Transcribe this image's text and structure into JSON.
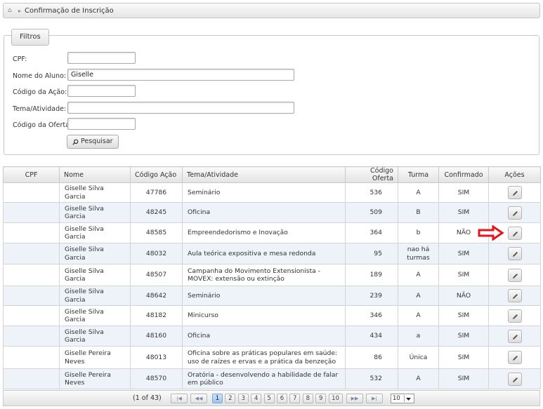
{
  "breadcrumb": {
    "title": "Confirmação de Inscrição",
    "home_icon": "home-icon"
  },
  "filters": {
    "legend": "Filtros",
    "fields": {
      "cpf": {
        "label": "CPF:",
        "value": ""
      },
      "aluno": {
        "label": "Nome do Aluno:",
        "value": "Giselle"
      },
      "codigo_acao": {
        "label": "Código da Ação:",
        "value": ""
      },
      "tema": {
        "label": "Tema/Atividade:",
        "value": ""
      },
      "codigo_oferta": {
        "label": "Código da Oferta:",
        "value": ""
      }
    },
    "search_button": "Pesquisar"
  },
  "table": {
    "headers": [
      "CPF",
      "Nome",
      "Código Ação",
      "Tema/Atividade",
      "Código Oferta",
      "Turma",
      "Confirmado",
      "Ações"
    ],
    "rows": [
      {
        "cpf": "",
        "nome": "Giselle Silva Garcia",
        "codigo_acao": "47786",
        "tema": "Seminário",
        "codigo_oferta": "536",
        "turma": "A",
        "confirmado": "SIM"
      },
      {
        "cpf": "",
        "nome": "Giselle Silva Garcia",
        "codigo_acao": "48245",
        "tema": "Oficina",
        "codigo_oferta": "509",
        "turma": "B",
        "confirmado": "SIM"
      },
      {
        "cpf": "",
        "nome": "Giselle Silva Garcia",
        "codigo_acao": "48585",
        "tema": "Empreendedorismo e Inovação",
        "codigo_oferta": "364",
        "turma": "b",
        "confirmado": "NÃO"
      },
      {
        "cpf": "",
        "nome": "Giselle Silva Garcia",
        "codigo_acao": "48032",
        "tema": "Aula teórica expositiva e mesa redonda",
        "codigo_oferta": "95",
        "turma": "nao há turmas",
        "confirmado": "SIM"
      },
      {
        "cpf": "",
        "nome": "Giselle Silva Garcia",
        "codigo_acao": "48507",
        "tema": "Campanha do Movimento Extensionista - MOVEX: extensão ou extinção",
        "codigo_oferta": "189",
        "turma": "A",
        "confirmado": "SIM"
      },
      {
        "cpf": "",
        "nome": "Giselle Silva Garcia",
        "codigo_acao": "48642",
        "tema": "Seminário",
        "codigo_oferta": "239",
        "turma": "A",
        "confirmado": "NÃO"
      },
      {
        "cpf": "",
        "nome": "Giselle Silva Garcia",
        "codigo_acao": "48182",
        "tema": "Minicurso",
        "codigo_oferta": "346",
        "turma": "A",
        "confirmado": "SIM"
      },
      {
        "cpf": "",
        "nome": "Giselle Silva Garcia",
        "codigo_acao": "48160",
        "tema": "Oficina",
        "codigo_oferta": "434",
        "turma": "a",
        "confirmado": "SIM"
      },
      {
        "cpf": "",
        "nome": "Giselle Pereira Neves",
        "codigo_acao": "48013",
        "tema": "Oficina sobre as práticas populares em saúde: uso de raízes e ervas e a prática da benzeção",
        "codigo_oferta": "86",
        "turma": "Única",
        "confirmado": "SIM"
      },
      {
        "cpf": "",
        "nome": "Giselle Pereira Neves",
        "codigo_acao": "48570",
        "tema": "Oratória - desenvolvendo a habilidade de falar em público",
        "codigo_oferta": "532",
        "turma": "A",
        "confirmado": "SIM"
      }
    ]
  },
  "pager": {
    "info": "(1 of 43)",
    "pages": [
      "1",
      "2",
      "3",
      "4",
      "5",
      "6",
      "7",
      "8",
      "9",
      "10"
    ],
    "current_page": "1",
    "rows_per_page": "10"
  },
  "colors": {
    "alt_row": "#eef3f9",
    "annotation_arrow": "#e8141b"
  }
}
